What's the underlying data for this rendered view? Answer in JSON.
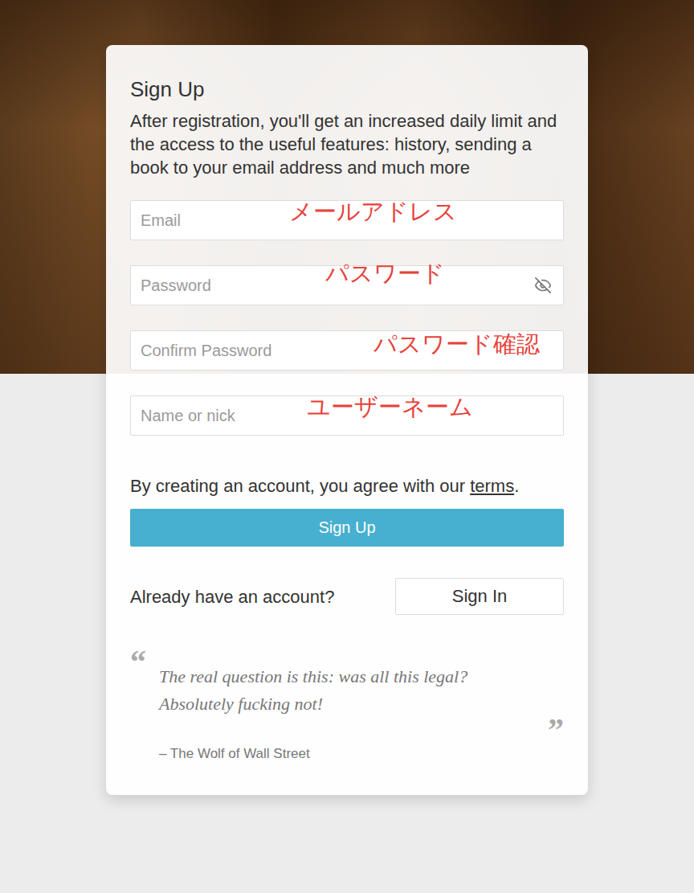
{
  "title": "Sign Up",
  "description": "After registration, you'll get an increased daily limit and the access to the useful features: history, sending a book to your email address and much more",
  "fields": [
    {
      "placeholder": "Email",
      "annotation": "メールアドレス",
      "kind": "text"
    },
    {
      "placeholder": "Password",
      "annotation": "パスワード",
      "kind": "toggle"
    },
    {
      "placeholder": "Confirm Password",
      "annotation": "パスワード確認",
      "kind": "text"
    },
    {
      "placeholder": "Name or nick",
      "annotation": "ユーザーネーム",
      "kind": "text"
    }
  ],
  "terms": {
    "before": "By creating an account, you agree with our ",
    "link": "terms",
    "after": "."
  },
  "submit": "Sign Up",
  "signin": {
    "prompt": "Already have an account?",
    "button": "Sign In"
  },
  "quote": {
    "open": "“",
    "text": "The real question is this: was all this legal? Absolutely fucking not!",
    "close": "”",
    "source": "– The Wolf of Wall Street"
  }
}
